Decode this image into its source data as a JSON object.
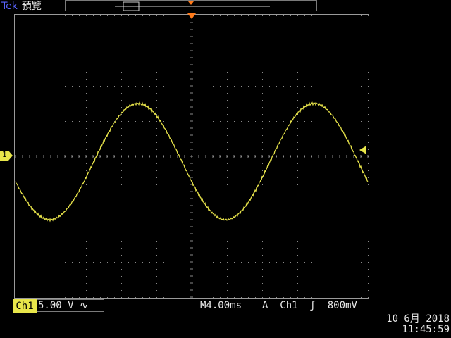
{
  "header": {
    "brand": "Tek",
    "mode": "預覽"
  },
  "channel": {
    "marker": "1",
    "badge": "Ch1",
    "scale": "5.00 V",
    "coupling_symbol": "∿"
  },
  "horizontal": {
    "timebase": "M4.00ms"
  },
  "trigger": {
    "mode": "A",
    "source": "Ch1",
    "slope_symbol": "ʃ",
    "level": "800mV"
  },
  "datetime": {
    "date": "10 6月  2018",
    "time": "11:45:59"
  },
  "colors": {
    "trace": "#e6e24a",
    "grid": "#8a8a8a",
    "trigger_marker": "#ff7a1a",
    "brand": "#5a64ff",
    "badge": "#e8e64a"
  },
  "waveform": {
    "type": "sine",
    "frequency_hz": 50,
    "amplitude_divisions": 1.65,
    "offset_divisions": 0.15,
    "phase_degrees": 200
  }
}
